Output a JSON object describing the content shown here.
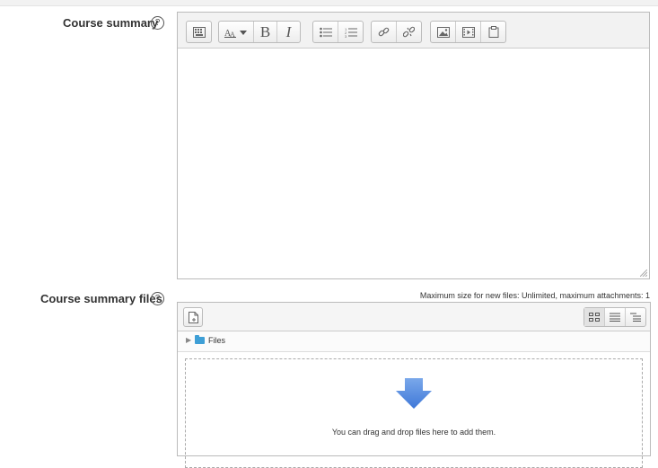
{
  "summary": {
    "label": "Course summary",
    "help": "?",
    "toolbar": {
      "buttons": [
        "show-more",
        "paragraph-styles",
        "bold",
        "italic",
        "unordered-list",
        "ordered-list",
        "link",
        "unlink",
        "image",
        "media",
        "manage-files"
      ],
      "bold_glyph": "B",
      "italic_glyph": "I"
    }
  },
  "files": {
    "label": "Course summary files",
    "help": "?",
    "max_info": "Maximum size for new files: Unlimited, maximum attachments: 1",
    "folder_name": "Files",
    "drop_text": "You can drag and drop files here to add them.",
    "views": [
      "icons",
      "list",
      "tree"
    ]
  },
  "colors": {
    "accent": "#3e9fd6",
    "arrow": "#4a86e0"
  }
}
